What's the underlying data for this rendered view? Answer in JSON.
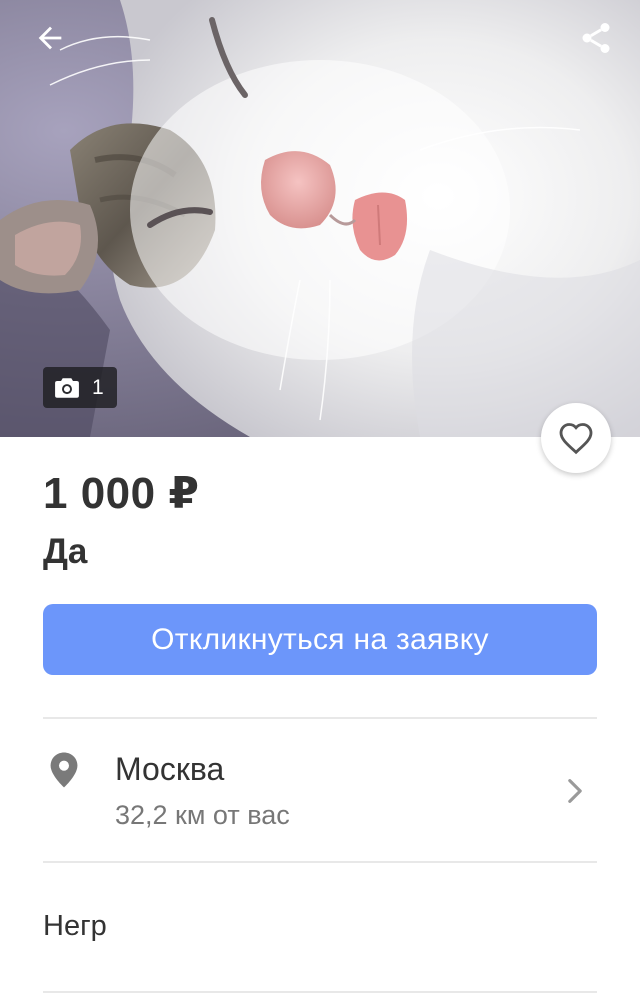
{
  "hero": {
    "photo_subject": "sleeping white cat",
    "photo_count": "1",
    "back_icon": "arrow-left-icon",
    "share_icon": "share-icon",
    "camera_icon": "camera-icon",
    "favorite_icon": "heart-outline-icon"
  },
  "listing": {
    "price": "1 000 ₽",
    "title": "Да",
    "respond_button_label": "Откликнуться на заявку",
    "description": "Негр"
  },
  "location": {
    "city": "Москва",
    "distance": "32,2 км от вас",
    "pin_icon": "map-pin-icon",
    "chevron_icon": "chevron-right-icon"
  },
  "colors": {
    "accent": "#6c96fa",
    "text_primary": "#333333",
    "text_secondary": "#777777",
    "divider": "#e8e8e8"
  }
}
